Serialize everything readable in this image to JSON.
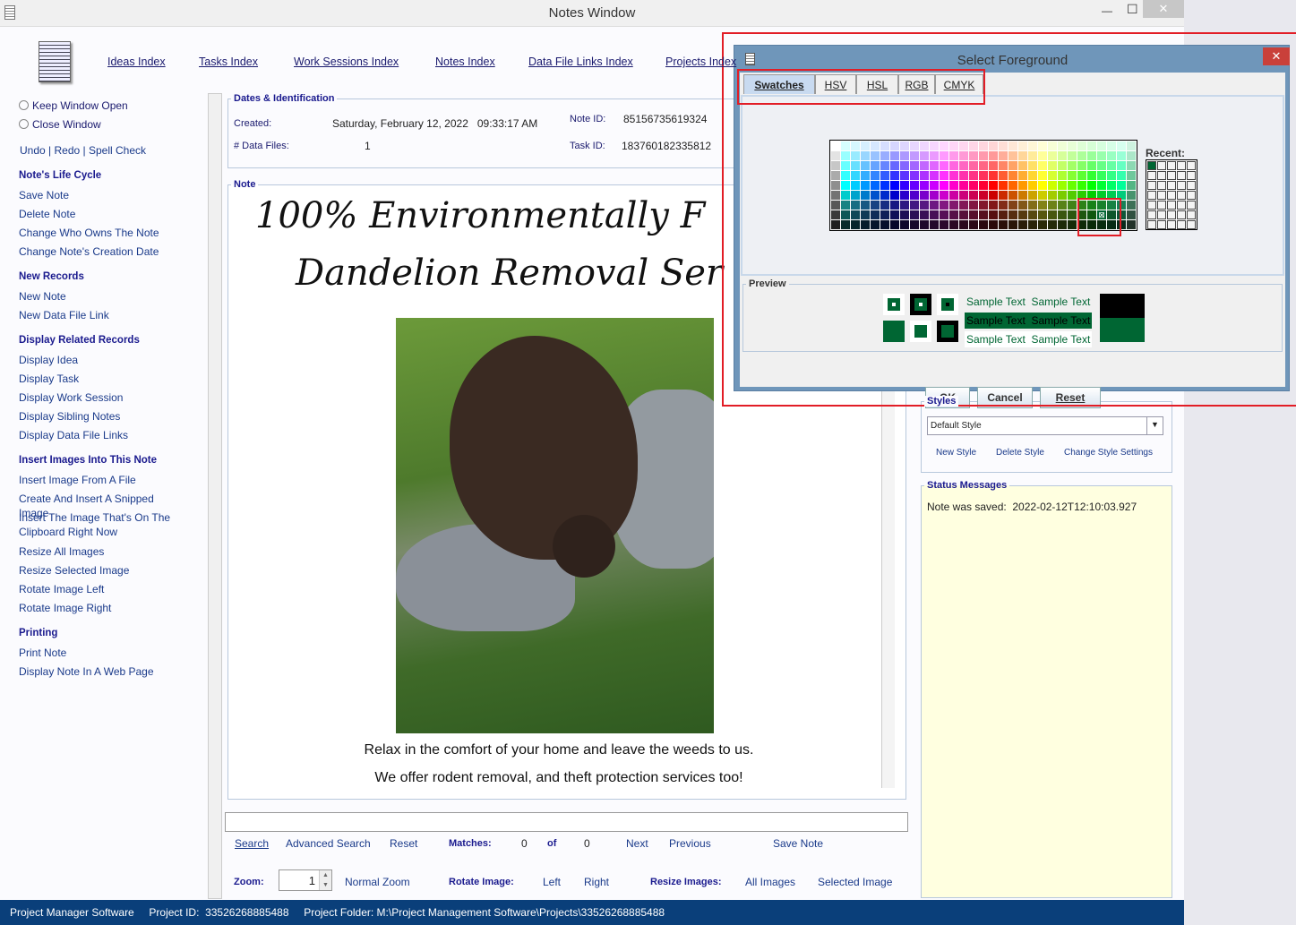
{
  "window": {
    "title": "Notes Window",
    "minimize": "—",
    "maximize": "☐",
    "close": "✕"
  },
  "nav": [
    "Ideas Index",
    "Tasks Index",
    "Work Sessions Index",
    "Notes Index",
    "Data File Links Index",
    "Projects Index"
  ],
  "window_options": {
    "keep_open": "Keep Window Open",
    "close": "Close Window",
    "undo": "Undo",
    "redo": "Redo",
    "spell": "Spell Check"
  },
  "sidebar": [
    {
      "h": "Note's Life Cycle",
      "items": [
        "Save Note",
        "Delete Note",
        "Change Who Owns The Note",
        "Change Note's Creation Date"
      ]
    },
    {
      "h": "New Records",
      "items": [
        "New Note",
        "New Data File Link"
      ]
    },
    {
      "h": "Display Related Records",
      "items": [
        "Display Idea",
        "Display Task",
        "Display Work Session",
        "Display Sibling Notes",
        "Display Data File Links"
      ]
    },
    {
      "h": "Insert Images Into This Note",
      "items": [
        "Insert Image From A File",
        "Create And Insert A Snipped Image",
        "Insert The Image That's On The Clipboard Right Now",
        "Resize All Images",
        "Resize Selected Image",
        "Rotate Image Left",
        "Rotate Image Right"
      ]
    },
    {
      "h": "Printing",
      "items": [
        "Print Note",
        "Display Note In A Web Page"
      ]
    }
  ],
  "dates": {
    "legend": "Dates & Identification",
    "created_label": "Created:",
    "created": "Saturday, February 12, 2022   09:33:17 AM",
    "files_label": "# Data Files:",
    "files": "1",
    "note_id_label": "Note ID:",
    "note_id": "85156735619324",
    "task_id_label": "Task ID:",
    "task_id": "183760182335812"
  },
  "note": {
    "legend": "Note",
    "line1": "100% Environmentally F",
    "line2": "Dandelion Removal Ser",
    "caption1": "Relax in the comfort of your home and leave the weeds to us.",
    "caption2": "We offer rodent removal, and theft protection services too!"
  },
  "search": {
    "value": "",
    "search": "Search",
    "advanced": "Advanced Search",
    "reset": "Reset",
    "matches_label": "Matches:",
    "matches": "0",
    "of": "of",
    "total": "0",
    "next": "Next",
    "previous": "Previous",
    "save": "Save Note"
  },
  "zoombar": {
    "zoom_label": "Zoom:",
    "zoom": "1",
    "normal": "Normal Zoom",
    "rotate_label": "Rotate Image:",
    "left": "Left",
    "right": "Right",
    "resize_label": "Resize Images:",
    "all": "All Images",
    "selected": "Selected Image"
  },
  "styles": {
    "legend": "Styles",
    "selected": "Default Style",
    "new": "New Style",
    "delete": "Delete Style",
    "change": "Change Style Settings"
  },
  "status_messages": {
    "legend": "Status Messages",
    "text": "Note was saved:  2022-02-12T12:10:03.927"
  },
  "statusbar": "Project Manager Software     Project ID:  33526268885488     Project Folder: M:\\Project Management Software\\Projects\\33526268885488",
  "dialog": {
    "title": "Select Foreground",
    "close": "✕",
    "tabs": [
      "Swatches",
      "HSV",
      "HSL",
      "RGB",
      "CMYK"
    ],
    "active_tab": "Swatches",
    "recent_label": "Recent:",
    "preview_label": "Preview",
    "sample": "Sample Text  Sample Text",
    "ok": "OK",
    "cancel": "Cancel",
    "reset": "Reset",
    "selected_color": "#006633",
    "recent_colors": [
      "#006633"
    ]
  },
  "colors": {
    "statusbar": "#0a3f7a",
    "status_bg": "#ffffe0",
    "highlight": "#e21d26",
    "dialog_frame": "#6f96ba"
  }
}
